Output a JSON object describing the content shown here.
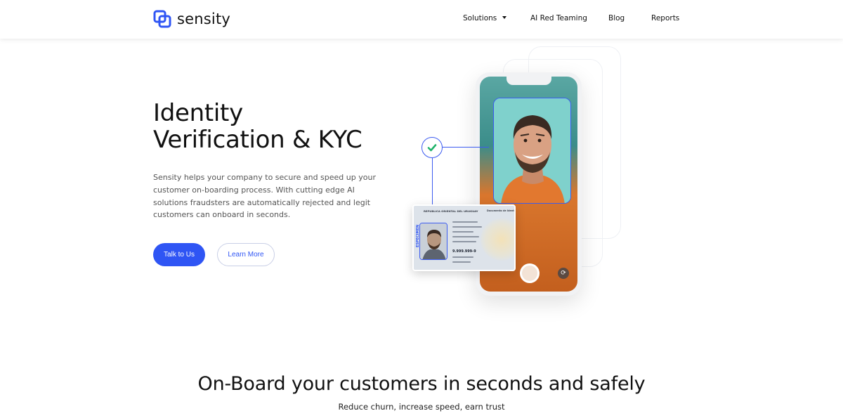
{
  "brand": {
    "name": "sensity",
    "accent": "#2f55f4"
  },
  "nav": {
    "items": [
      {
        "label": "Solutions",
        "has_dropdown": true
      },
      {
        "label": "AI Red Teaming"
      },
      {
        "label": "Blog"
      },
      {
        "label": "Reports"
      }
    ]
  },
  "hero": {
    "title_line1": "Identity",
    "title_line2": "Verification & KYC",
    "description": "Sensity helps your company to secure and speed up your customer on-boarding process. With cutting edge AI solutions fraudsters are automatically rejected and legit customers can onboard in seconds.",
    "primary_cta": "Talk to Us",
    "secondary_cta": "Learn More"
  },
  "illustration": {
    "verified_icon": "checkmark-icon",
    "id_card": {
      "header": "REPUBLICA ORIENTAL DEL URUGUAY",
      "stamp": "ESPECIMEN",
      "doc_type": "Documento de Identidad",
      "number": "9.999.999-9"
    }
  },
  "section2": {
    "title": "On-Board your customers in seconds and safely",
    "subtitle": "Reduce churn, increase speed, earn trust"
  }
}
